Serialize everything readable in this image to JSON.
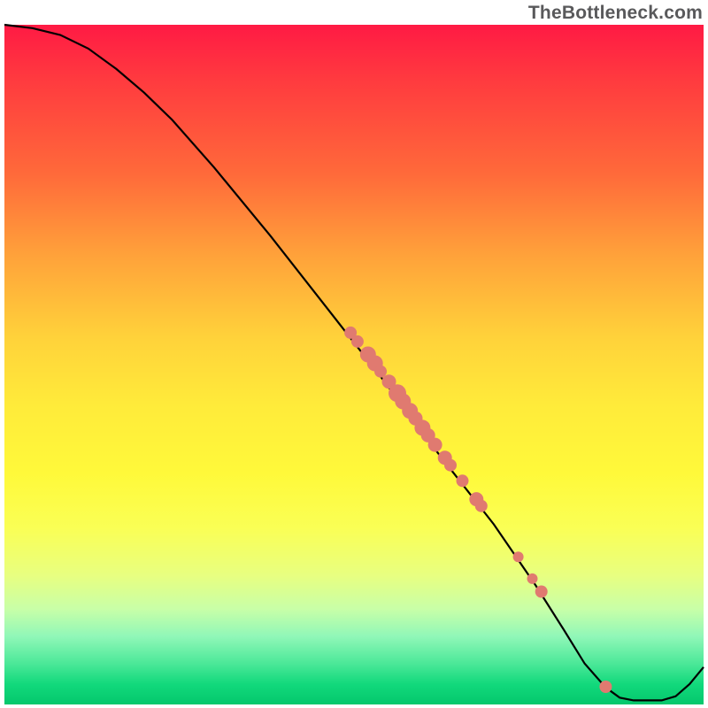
{
  "watermark": "TheBottleneck.com",
  "colors": {
    "curve": "#000000",
    "point_fill": "#e07a70",
    "gradient_top": "#ff1a44",
    "gradient_bottom": "#04c76c"
  },
  "chart_data": {
    "type": "line",
    "title": "",
    "xlabel": "",
    "ylabel": "",
    "xlim": [
      0,
      100
    ],
    "ylim": [
      0,
      100
    ],
    "curve": [
      {
        "x": 0,
        "y": 100
      },
      {
        "x": 4,
        "y": 99.5
      },
      {
        "x": 8,
        "y": 98.5
      },
      {
        "x": 12,
        "y": 96.5
      },
      {
        "x": 16,
        "y": 93.5
      },
      {
        "x": 20,
        "y": 90.0
      },
      {
        "x": 24,
        "y": 86.0
      },
      {
        "x": 30,
        "y": 79.0
      },
      {
        "x": 38,
        "y": 69.0
      },
      {
        "x": 46,
        "y": 58.5
      },
      {
        "x": 54,
        "y": 48.0
      },
      {
        "x": 62,
        "y": 37.0
      },
      {
        "x": 70,
        "y": 26.5
      },
      {
        "x": 76,
        "y": 17.5
      },
      {
        "x": 80,
        "y": 11.0
      },
      {
        "x": 83,
        "y": 6.0
      },
      {
        "x": 86,
        "y": 2.5
      },
      {
        "x": 88,
        "y": 1.0
      },
      {
        "x": 90,
        "y": 0.6
      },
      {
        "x": 94,
        "y": 0.6
      },
      {
        "x": 96,
        "y": 1.2
      },
      {
        "x": 98,
        "y": 3.0
      },
      {
        "x": 100,
        "y": 5.5
      }
    ],
    "series": [
      {
        "name": "markers",
        "points": [
          {
            "x": 49.5,
            "y": 54.7,
            "r": 7
          },
          {
            "x": 50.5,
            "y": 53.4,
            "r": 7
          },
          {
            "x": 52.0,
            "y": 51.5,
            "r": 9
          },
          {
            "x": 53.0,
            "y": 50.2,
            "r": 9
          },
          {
            "x": 53.8,
            "y": 49.0,
            "r": 7
          },
          {
            "x": 55.0,
            "y": 47.5,
            "r": 8
          },
          {
            "x": 56.2,
            "y": 45.8,
            "r": 10
          },
          {
            "x": 57.0,
            "y": 44.6,
            "r": 9
          },
          {
            "x": 58.0,
            "y": 43.2,
            "r": 9
          },
          {
            "x": 58.8,
            "y": 42.1,
            "r": 8
          },
          {
            "x": 59.8,
            "y": 40.7,
            "r": 9
          },
          {
            "x": 60.6,
            "y": 39.6,
            "r": 8
          },
          {
            "x": 61.6,
            "y": 38.2,
            "r": 8
          },
          {
            "x": 63.0,
            "y": 36.3,
            "r": 8
          },
          {
            "x": 63.8,
            "y": 35.2,
            "r": 7
          },
          {
            "x": 65.5,
            "y": 32.9,
            "r": 7
          },
          {
            "x": 67.5,
            "y": 30.2,
            "r": 8
          },
          {
            "x": 68.2,
            "y": 29.2,
            "r": 7
          },
          {
            "x": 73.5,
            "y": 21.7,
            "r": 6
          },
          {
            "x": 75.5,
            "y": 18.5,
            "r": 6
          },
          {
            "x": 76.8,
            "y": 16.6,
            "r": 7
          },
          {
            "x": 86.0,
            "y": 2.6,
            "r": 7
          }
        ]
      }
    ]
  }
}
